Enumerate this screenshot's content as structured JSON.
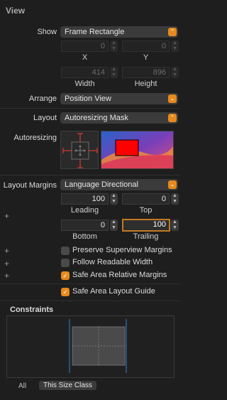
{
  "section_title": "View",
  "show": {
    "label": "Show",
    "value": "Frame Rectangle"
  },
  "frame": {
    "x": {
      "value": "0",
      "label": "X"
    },
    "y": {
      "value": "0",
      "label": "Y"
    },
    "width": {
      "value": "414",
      "label": "Width"
    },
    "height": {
      "value": "896",
      "label": "Height"
    }
  },
  "arrange": {
    "label": "Arrange",
    "value": "Position View"
  },
  "layout": {
    "label": "Layout",
    "value": "Autoresizing Mask"
  },
  "autoresizing": {
    "label": "Autoresizing"
  },
  "layout_margins": {
    "label": "Layout Margins",
    "value": "Language Directional",
    "leading": {
      "value": "100",
      "label": "Leading"
    },
    "top": {
      "value": "0",
      "label": "Top"
    },
    "bottom": {
      "value": "0",
      "label": "Bottom"
    },
    "trailing": {
      "value": "100",
      "label": "Trailing"
    }
  },
  "checkboxes": {
    "preserve_superview": {
      "label": "Preserve Superview Margins",
      "checked": false
    },
    "follow_readable": {
      "label": "Follow Readable Width",
      "checked": false
    },
    "safe_area_relative": {
      "label": "Safe Area Relative Margins",
      "checked": true
    },
    "safe_area_guide": {
      "label": "Safe Area Layout Guide",
      "checked": true
    }
  },
  "constraints": {
    "title": "Constraints",
    "tabs": [
      "All",
      "This Size Class"
    ],
    "selected_tab": "This Size Class"
  },
  "symbols": {
    "plus": "+",
    "check": "✓",
    "popup_arrows": "⌃⌄",
    "step_up": "▲",
    "step_down": "▼"
  },
  "colors": {
    "accent": "#e58a1c",
    "background": "#1e1e1e",
    "autoresize_red": "#ff0000"
  }
}
